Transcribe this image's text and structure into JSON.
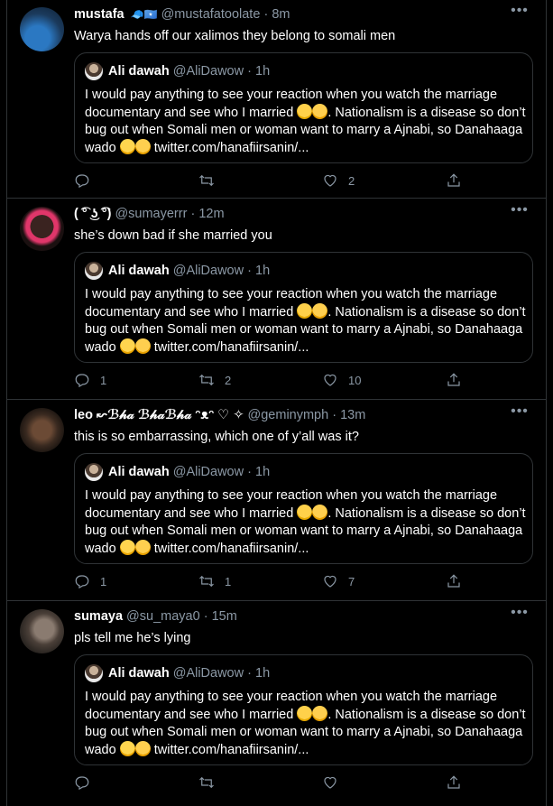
{
  "quoted": {
    "name": "Ali dawah",
    "handle": "@AliDawow",
    "dot": "·",
    "time": "1h",
    "body_part1": "I would pay anything to see your reaction when you watch the marriage documentary and see who I married ",
    "body_part2": ". Nationalism is a disease so don’t bug out when Somali men or woman want to marry a Ajnabi, so Danahaaga wado ",
    "link": "twitter.com/hanafiirsanin/..."
  },
  "tweets": [
    {
      "name": "mustafa",
      "badges": "🧢🇸🇴",
      "handle": "@mustafatoolate",
      "dot": "·",
      "time": "8m",
      "text": "Warya hands off our xalimos they belong to somali men",
      "reply_count": "",
      "retweet_count": "",
      "like_count": "2",
      "avatar_colors": [
        "#1b3a5c",
        "#2b78c2"
      ]
    },
    {
      "name": "( ͡° ͜ʖ ͡°)",
      "badges": "",
      "handle": "@sumayerrr",
      "dot": "·",
      "time": "12m",
      "text": "she’s down bad if she married you",
      "reply_count": "1",
      "retweet_count": "2",
      "like_count": "10",
      "avatar_colors": [
        "#2a1a1a",
        "#e0366a"
      ]
    },
    {
      "name": "leo ↜ℬ𝒽𝒶 ℬ𝒽𝒶ℬ𝒽𝒶 ᵔᴥᵔ ♡ ✧",
      "badges": "",
      "handle": "@geminymph",
      "dot": "·",
      "time": "13m",
      "text": "this is so embarrassing, which one of y’all was it?",
      "reply_count": "1",
      "retweet_count": "1",
      "like_count": "7",
      "avatar_colors": [
        "#1a1410",
        "#6b4a35"
      ]
    },
    {
      "name": "sumaya",
      "badges": "",
      "handle": "@su_maya0",
      "dot": "·",
      "time": "15m",
      "text": "pls tell me he’s lying",
      "reply_count": "",
      "retweet_count": "",
      "like_count": "",
      "avatar_colors": [
        "#2b2622",
        "#8a7b70"
      ]
    }
  ]
}
